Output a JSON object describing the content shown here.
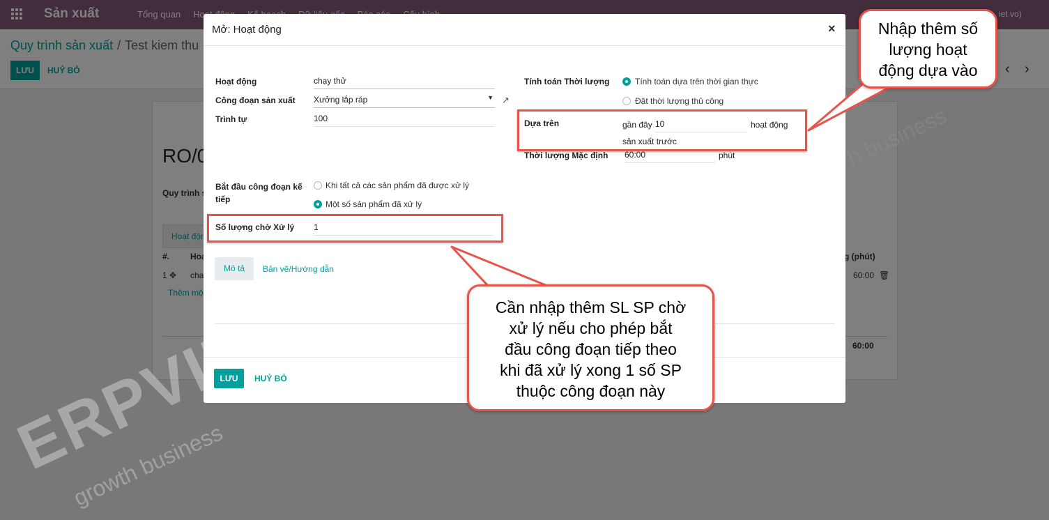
{
  "app": {
    "title": "Sản xuất",
    "menu": [
      "Tổng quan",
      "Hoạt động",
      "Kế hoạch",
      "Dữ liệu gốc",
      "Báo cáo",
      "Cấu hình"
    ],
    "user_fragment": "iet vo)"
  },
  "breadcrumb": {
    "parent": "Quy trình sản xuất",
    "current": "Test kiem thu"
  },
  "control": {
    "save_label": "LƯU",
    "discard_label": "HUỶ BỎ"
  },
  "sheet": {
    "title": "RO/0",
    "label": "Quy trình s",
    "tab": "Hoạt độn",
    "col_num": "#.",
    "col_name": "Hoạ",
    "col_duration": "g (phút)",
    "row_num": "1",
    "row_name": "cha",
    "row_duration": "60:00",
    "add_line": "Thêm mộ",
    "total": "60:00"
  },
  "modal": {
    "title": "Mở: Hoạt động",
    "fields": {
      "activity_label": "Hoạt động",
      "activity_value": "chạy thử",
      "workcenter_label": "Công đoạn sản xuất",
      "workcenter_value": "Xưởng lắp ráp",
      "sequence_label": "Trình tự",
      "sequence_value": "100",
      "start_next_label": "Bắt đầu công đoạn kế tiếp",
      "start_next_opt1": "Khi tất cả các sản phẩm đã được xử lý",
      "start_next_opt2": "Một số sản phẩm đã xử lý",
      "qty_label": "Số lượng chờ Xử lý",
      "qty_value": "1",
      "duration_compute_label": "Tính toán Thời lượng",
      "duration_opt1": "Tính toán dựa trên thời gian thực",
      "duration_opt2": "Đặt thời lượng thủ công",
      "based_on_label": "Dựa trên",
      "based_on_prefix": "gần đây",
      "based_on_value": "10",
      "based_on_suffix": "hoạt động",
      "based_on_suffix2": "sản xuất trước",
      "default_duration_label": "Thời lượng Mặc định",
      "default_duration_value": "60:00",
      "default_duration_unit": "phút"
    },
    "tabs": {
      "description": "Mô tả",
      "drawings": "Bản vẽ/Hướng dẫn"
    },
    "footer": {
      "save_label": "LƯU",
      "discard_label": "HUỶ BỎ"
    }
  },
  "annotations": {
    "callout_top": [
      "Nhập thêm số",
      "lượng hoạt",
      "động dựa vào"
    ],
    "callout_bottom": [
      "Cần nhập thêm SL SP chờ",
      "xử lý nếu cho phép bắt",
      "đầu công đoạn tiếp theo",
      "khi đã xử lý xong 1 số SP",
      "thuộc công đoạn này"
    ]
  },
  "watermark": {
    "brand": "ERPVIET",
    "tagline": "growth business",
    "tagline2": "h business"
  },
  "colors": {
    "brand": "#875a7b",
    "accent": "#00a09d",
    "annotation": "#e8534a"
  }
}
